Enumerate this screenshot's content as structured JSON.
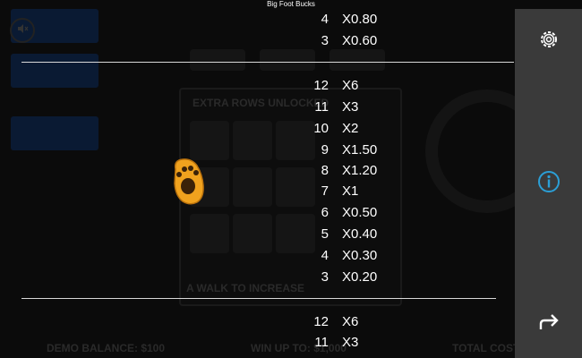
{
  "app": {
    "title": "Big Foot Bucks"
  },
  "background": {
    "balance_label": "DEMO BALANCE: $100",
    "win_label": "WIN UP TO: $1,000",
    "cost_label": "TOTAL COST: $",
    "extra_rows_label": "EXTRA ROWS UNLOCKED",
    "walk_label": "A WALK TO INCREASE"
  },
  "paytable": {
    "rows_top": [
      {
        "count": "4",
        "mult": "X0.80"
      },
      {
        "count": "3",
        "mult": "X0.60"
      }
    ],
    "rows_mid": [
      {
        "count": "12",
        "mult": "X6"
      },
      {
        "count": "11",
        "mult": "X3"
      },
      {
        "count": "10",
        "mult": "X2"
      },
      {
        "count": "9",
        "mult": "X1.50"
      },
      {
        "count": "8",
        "mult": "X1.20"
      },
      {
        "count": "7",
        "mult": "X1"
      },
      {
        "count": "6",
        "mult": "X0.50"
      },
      {
        "count": "5",
        "mult": "X0.40"
      },
      {
        "count": "4",
        "mult": "X0.30"
      },
      {
        "count": "3",
        "mult": "X0.20"
      }
    ],
    "rows_bottom": [
      {
        "count": "12",
        "mult": "X6"
      },
      {
        "count": "11",
        "mult": "X3"
      }
    ]
  },
  "icons": {
    "mute": "speaker-mute-icon",
    "symbol": "paw-print-icon",
    "settings": "gear-icon",
    "info": "info-icon",
    "back": "return-arrow-icon"
  },
  "colors": {
    "accent_blue": "#2b9fd6",
    "paw_orange": "#f0a21e",
    "sidebar": "#3a3a3a"
  }
}
